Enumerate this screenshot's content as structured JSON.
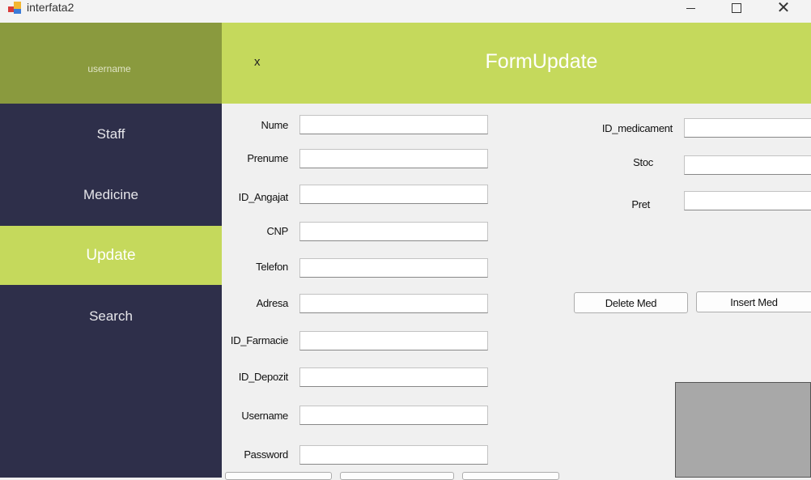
{
  "window": {
    "title": "interfata2"
  },
  "sidebar": {
    "username": "username",
    "items": [
      {
        "label": "Staff"
      },
      {
        "label": "Medicine"
      },
      {
        "label": "Update"
      },
      {
        "label": "Search"
      }
    ]
  },
  "header": {
    "close_label": "x",
    "title": "FormUpdate"
  },
  "staff_form": {
    "fields": [
      {
        "label": "Nume",
        "value": ""
      },
      {
        "label": "Prenume",
        "value": ""
      },
      {
        "label": "ID_Angajat",
        "value": ""
      },
      {
        "label": "CNP",
        "value": ""
      },
      {
        "label": "Telefon",
        "value": ""
      },
      {
        "label": "Adresa",
        "value": ""
      },
      {
        "label": "ID_Farmacie",
        "value": ""
      },
      {
        "label": "ID_Depozit",
        "value": ""
      },
      {
        "label": "Username",
        "value": ""
      },
      {
        "label": "Password",
        "value": ""
      }
    ]
  },
  "med_form": {
    "fields": [
      {
        "label": "ID_medicament",
        "value": ""
      },
      {
        "label": "Stoc",
        "value": ""
      },
      {
        "label": "Pret",
        "value": ""
      }
    ],
    "delete_label": "Delete Med",
    "insert_label": "Insert Med"
  }
}
